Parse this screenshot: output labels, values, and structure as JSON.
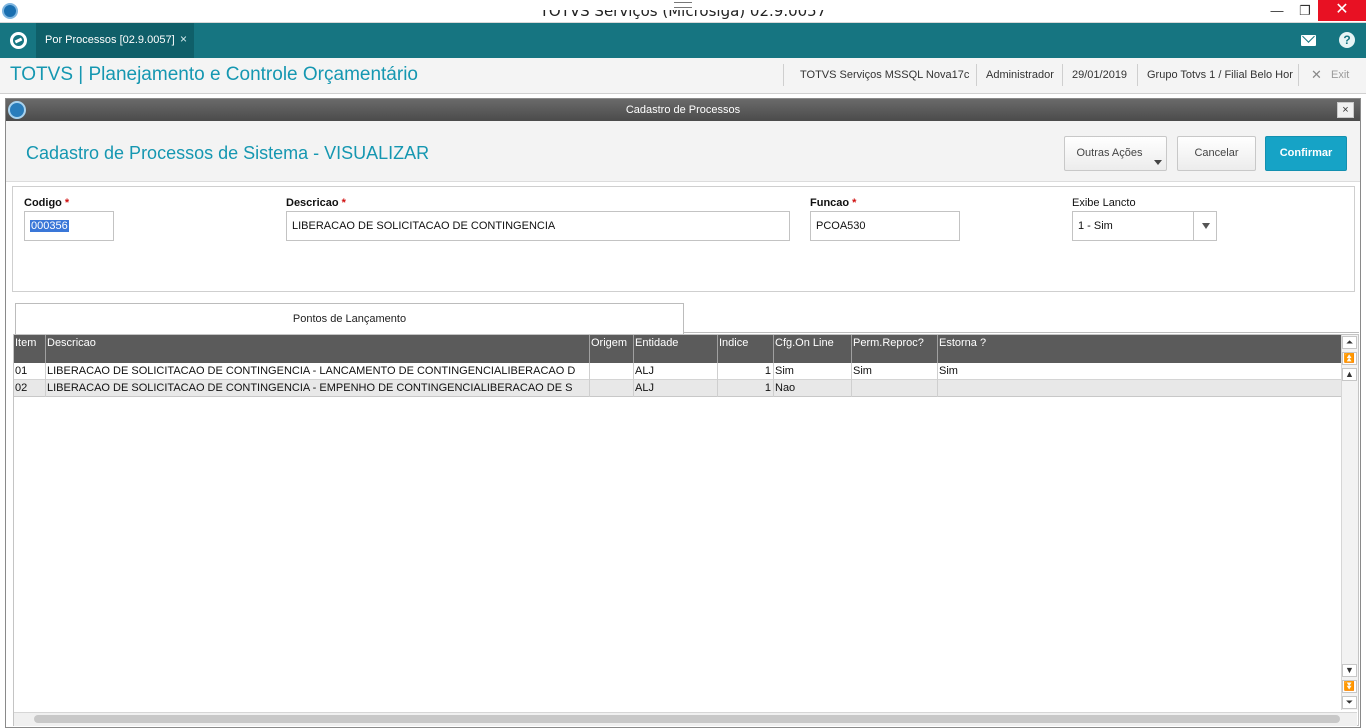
{
  "window": {
    "title": "TOTVS Serviços (Microsiga) 02.9.0057",
    "minimize": "—",
    "maximize": "❐",
    "close": "✕"
  },
  "tabs": {
    "active_label": "Por Processos [02.9.0057]",
    "close_glyph": "×",
    "help_glyph": "?"
  },
  "header": {
    "app_title": "TOTVS | Planejamento e Controle Orçamentário",
    "environment": "TOTVS Serviços MSSQL Nova17c",
    "user": "Administrador",
    "date": "29/01/2019",
    "branch": "Grupo Totvs 1 / Filial Belo Hor",
    "exit_glyph": "✕",
    "exit_label": "Exit"
  },
  "dialog": {
    "title": "Cadastro de Processos",
    "close_glyph": "×",
    "heading": "Cadastro de Processos de Sistema - VISUALIZAR",
    "buttons": {
      "more_actions": "Outras Ações",
      "cancel": "Cancelar",
      "confirm": "Confirmar"
    }
  },
  "form": {
    "required_mark": "*",
    "codigo": {
      "label": "Codigo",
      "value": "000356"
    },
    "descricao": {
      "label": "Descricao",
      "value": "LIBERACAO DE SOLICITACAO DE CONTINGENCIA"
    },
    "funcao": {
      "label": "Funcao",
      "value": "PCOA530"
    },
    "exibe_lancto": {
      "label": "Exibe Lancto",
      "value": "1 - Sim"
    }
  },
  "folder_tab": "Pontos de Lançamento",
  "grid": {
    "columns": [
      "Item",
      "Descricao",
      "Origem",
      "Entidade",
      "Indice",
      "Cfg.On Line",
      "Perm.Reproc?",
      "Estorna ?"
    ],
    "rows": [
      [
        "01",
        "LIBERACAO DE SOLICITACAO DE CONTINGENCIA - LANCAMENTO DE CONTINGENCIALIBERACAO D",
        "",
        "ALJ",
        "1",
        "Sim",
        "Sim",
        "Sim"
      ],
      [
        "02",
        "LIBERACAO DE SOLICITACAO DE CONTINGENCIA - EMPENHO DE CONTINGENCIALIBERACAO DE S",
        "",
        "ALJ",
        "1",
        "Nao",
        "",
        ""
      ]
    ]
  },
  "scroll": {
    "top": "⏶",
    "page_up": "⏫",
    "up": "▲",
    "down": "▼",
    "page_down": "⏬",
    "bottom": "⏷"
  }
}
